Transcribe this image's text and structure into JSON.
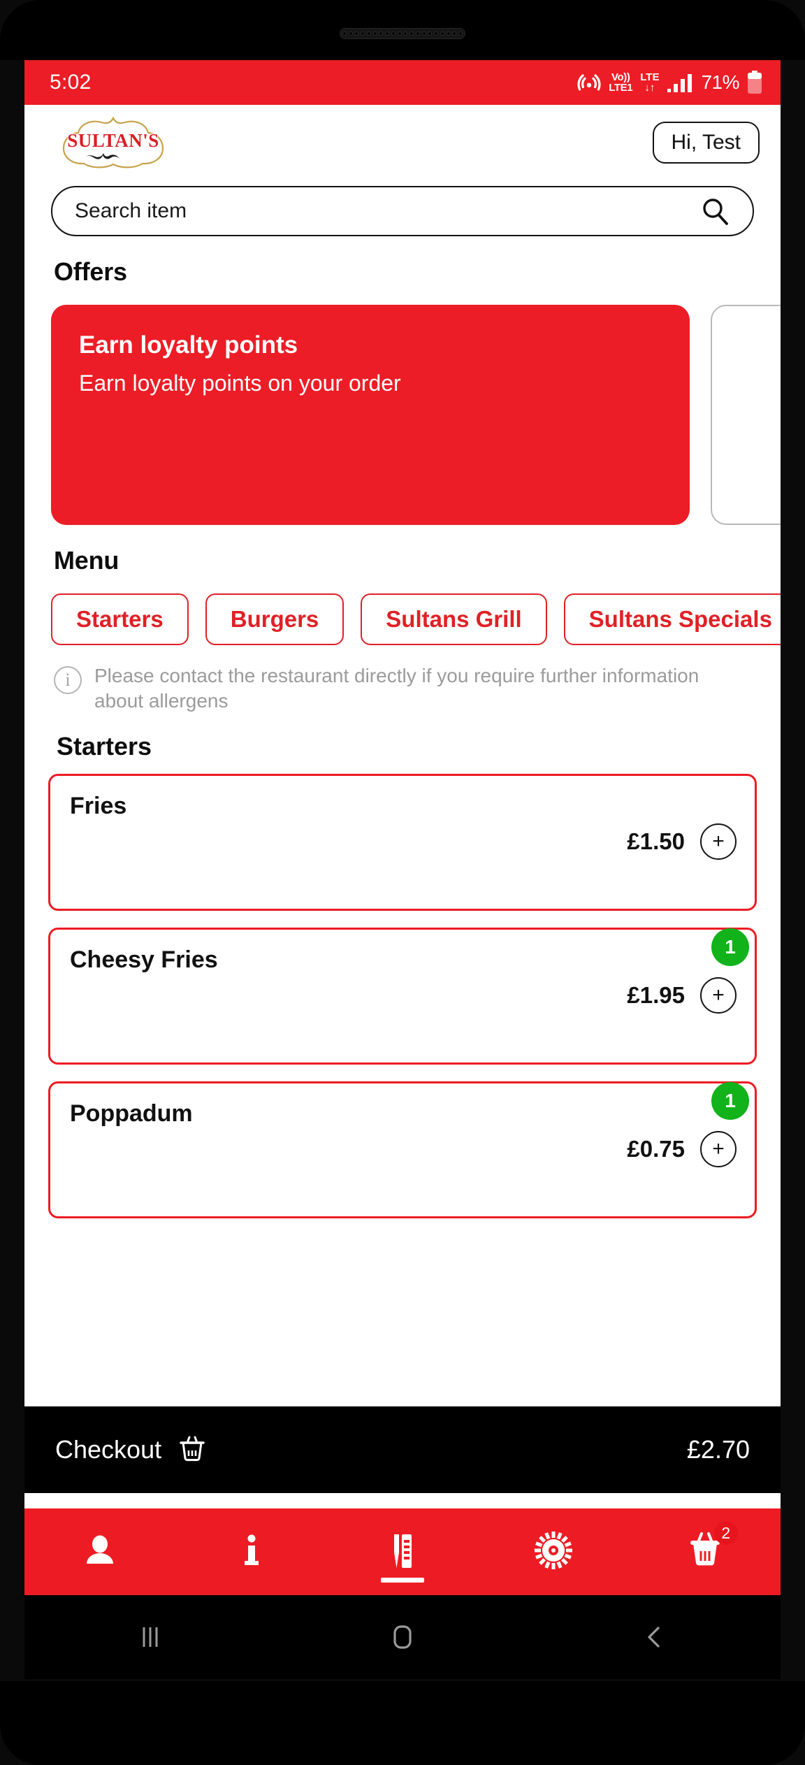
{
  "status_bar": {
    "time": "5:02",
    "volte_top": "Vo))",
    "volte_bottom": "LTE1",
    "lte_top": "LTE",
    "lte_bottom": "↓↑",
    "battery_percent": "71%",
    "background_color": "#ec1d26"
  },
  "header": {
    "logo_text": "SULTAN'S",
    "greeting_button": "Hi, Test"
  },
  "search": {
    "placeholder": "Search item",
    "value": ""
  },
  "offers": {
    "section_title": "Offers",
    "cards": [
      {
        "title": "Earn loyalty points",
        "subtitle": "Earn loyalty points on your order"
      }
    ]
  },
  "menu": {
    "section_title": "Menu",
    "categories": [
      {
        "label": "Starters"
      },
      {
        "label": "Burgers"
      },
      {
        "label": "Sultans Grill"
      },
      {
        "label": "Sultans Specials"
      }
    ],
    "allergen_notice": "Please contact the restaurant directly if you require further information about allergens",
    "group_title": "Starters",
    "items": [
      {
        "name": "Fries",
        "price": "£1.50",
        "qty": "",
        "add_label": "+"
      },
      {
        "name": "Cheesy Fries",
        "price": "£1.95",
        "qty": "1",
        "add_label": "+"
      },
      {
        "name": "Poppadum",
        "price": "£0.75",
        "qty": "1",
        "add_label": "+"
      }
    ]
  },
  "checkout": {
    "label": "Checkout",
    "total": "£2.70"
  },
  "bottom_nav": {
    "items": [
      {
        "name": "account",
        "icon": "person-icon",
        "badge": ""
      },
      {
        "name": "info",
        "icon": "info-icon",
        "badge": ""
      },
      {
        "name": "menu",
        "icon": "menu-book-icon",
        "badge": ""
      },
      {
        "name": "settings",
        "icon": "gear-icon",
        "badge": ""
      },
      {
        "name": "basket",
        "icon": "basket-icon",
        "badge": "2"
      }
    ]
  },
  "system_nav": {
    "recents": "recents-icon",
    "home": "home-icon",
    "back": "back-icon"
  },
  "colors": {
    "brand_red": "#ed1c24",
    "status_red": "#ec1d26",
    "badge_green": "#12b21a",
    "black": "#000000"
  }
}
